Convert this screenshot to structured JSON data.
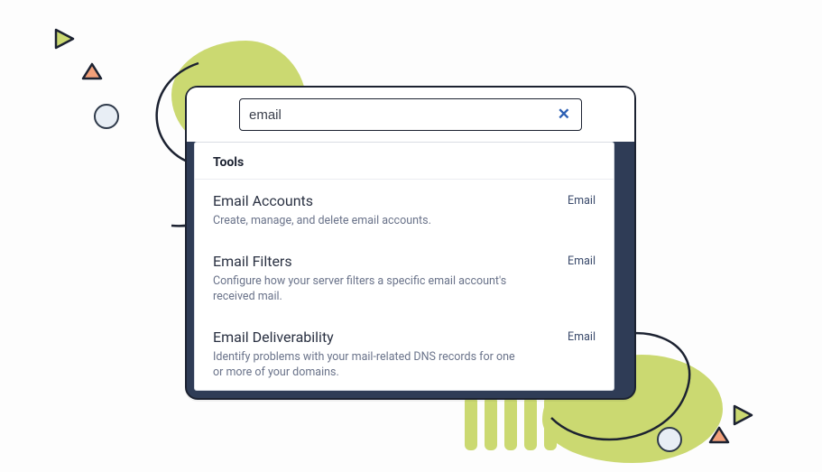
{
  "search": {
    "value": "email",
    "clear_glyph": "✕"
  },
  "section_header": "Tools",
  "results": [
    {
      "title": "Email Accounts",
      "desc": "Create, manage, and delete email accounts.",
      "tag": "Email"
    },
    {
      "title": "Email Filters",
      "desc": "Configure how your server filters a specific email account's received mail.",
      "tag": "Email"
    },
    {
      "title": "Email Deliverability",
      "desc": "Identify problems with your mail-related DNS records for one or more of your domains.",
      "tag": "Email"
    }
  ]
}
